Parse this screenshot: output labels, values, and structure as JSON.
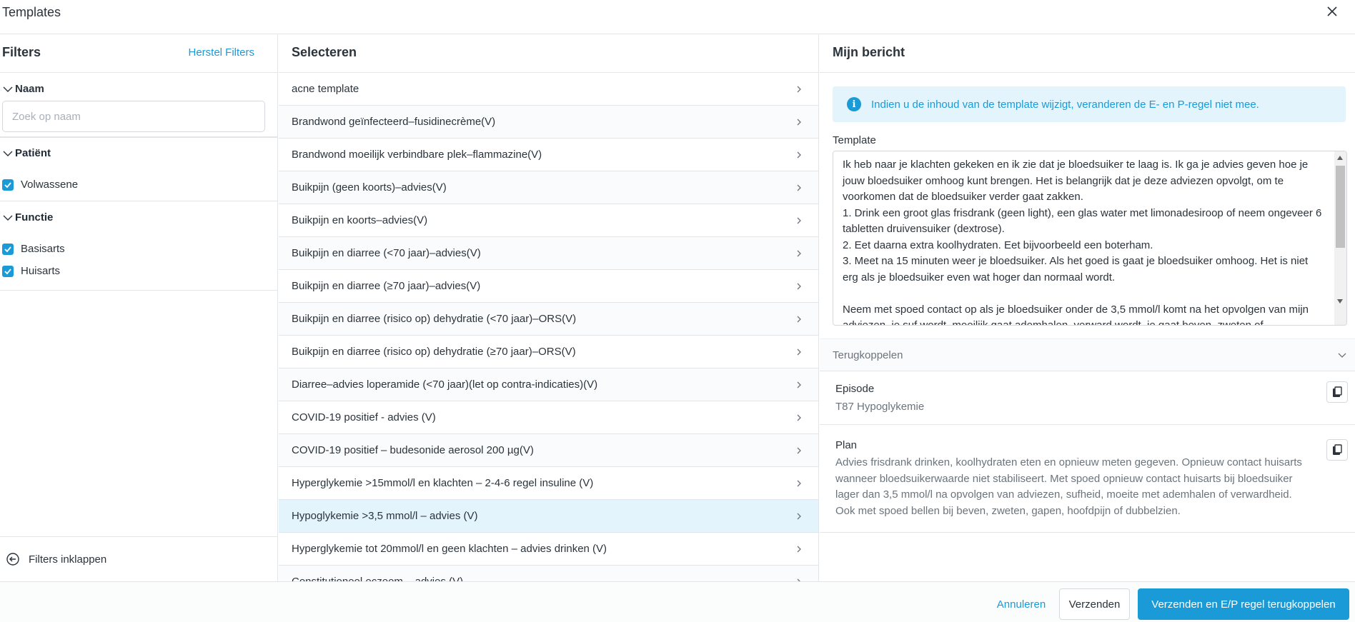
{
  "window": {
    "title": "Templates"
  },
  "filters": {
    "heading": "Filters",
    "reset_label": "Herstel Filters",
    "naam": {
      "label": "Naam",
      "search_placeholder": "Zoek op naam"
    },
    "patient": {
      "label": "Patiënt",
      "options": [
        {
          "label": "Volwassene",
          "checked": true
        }
      ]
    },
    "functie": {
      "label": "Functie",
      "options": [
        {
          "label": "Basisarts",
          "checked": true
        },
        {
          "label": "Huisarts",
          "checked": true
        }
      ]
    },
    "collapse_label": "Filters inklappen"
  },
  "select": {
    "heading": "Selecteren",
    "items": [
      "acne template",
      "Brandwond geïnfecteerd–fusidinecrème(V)",
      "Brandwond moeilijk verbindbare plek–flammazine(V)",
      "Buikpijn (geen koorts)–advies(V)",
      "Buikpijn en koorts–advies(V)",
      "Buikpijn en diarree (<70 jaar)–advies(V)",
      "Buikpijn en diarree (≥70 jaar)–advies(V)",
      "Buikpijn en diarree (risico op) dehydratie (<70 jaar)–ORS(V)",
      "Buikpijn en diarree (risico op) dehydratie (≥70 jaar)–ORS(V)",
      "Diarree–advies loperamide (<70 jaar)(let op contra-indicaties)(V)",
      "COVID-19 positief - advies (V)",
      "COVID-19 positief – budesonide aerosol 200 µg(V)",
      "Hyperglykemie >15mmol/l en klachten – 2-4-6 regel insuline (V)",
      "Hypoglykemie >3,5 mmol/l – advies (V)",
      "Hyperglykemie tot 20mmol/l en geen klachten – advies drinken (V)",
      "Constitutioneel eczeem – advies (V)"
    ],
    "selected_index": 13
  },
  "message": {
    "heading": "Mijn bericht",
    "info": "Indien u de inhoud van de template wijzigt, veranderen de E- en P-regel niet mee.",
    "template_label": "Template",
    "template_text": "Ik heb naar je klachten gekeken en ik zie dat je bloedsuiker te laag is. Ik ga je advies geven hoe je jouw bloedsuiker omhoog kunt brengen. Het is belangrijk dat je deze adviezen opvolgt, om te voorkomen dat de bloedsuiker verder gaat zakken.\n1. Drink een groot glas frisdrank (geen light), een glas water met limonadesiroop of neem ongeveer 6 tabletten druivensuiker (dextrose).\n2. Eet daarna extra koolhydraten. Eet bijvoorbeeld een boterham.\n3. Meet na 15 minuten weer je bloedsuiker. Als het goed is gaat je bloedsuiker omhoog. Het is niet erg als je bloedsuiker even wat hoger dan normaal wordt.\n\nNeem met spoed contact op als je bloedsuiker onder de 3,5 mmol/l komt na het opvolgen van mijn adviezen, je suf wordt, moeilijk gaat ademhalen, verward wordt, je gaat beven, zweten of",
    "feedback": {
      "label": "Terugkoppelen",
      "episode_label": "Episode",
      "episode_value": "T87 Hypoglykemie",
      "plan_label": "Plan",
      "plan_value": "Advies frisdrank drinken, koolhydraten eten en opnieuw meten gegeven. Opnieuw contact huisarts wanneer bloedsuikerwaarde niet stabiliseert. Met spoed opnieuw contact huisarts bij bloedsuiker lager dan 3,5 mmol/l na opvolgen van adviezen, sufheid, moeite met ademhalen of verwardheid. Ook met spoed bellen bij beven, zweten, gapen, hoofdpijn of dubbelzien."
    }
  },
  "footer": {
    "cancel_label": "Annuleren",
    "send_label": "Verzenden",
    "send_ep_label": "Verzenden en E/P regel terugkoppelen"
  },
  "colors": {
    "accent": "#1a9bd7",
    "selected_row": "#e3f4fc",
    "border": "#e3e6e9"
  }
}
